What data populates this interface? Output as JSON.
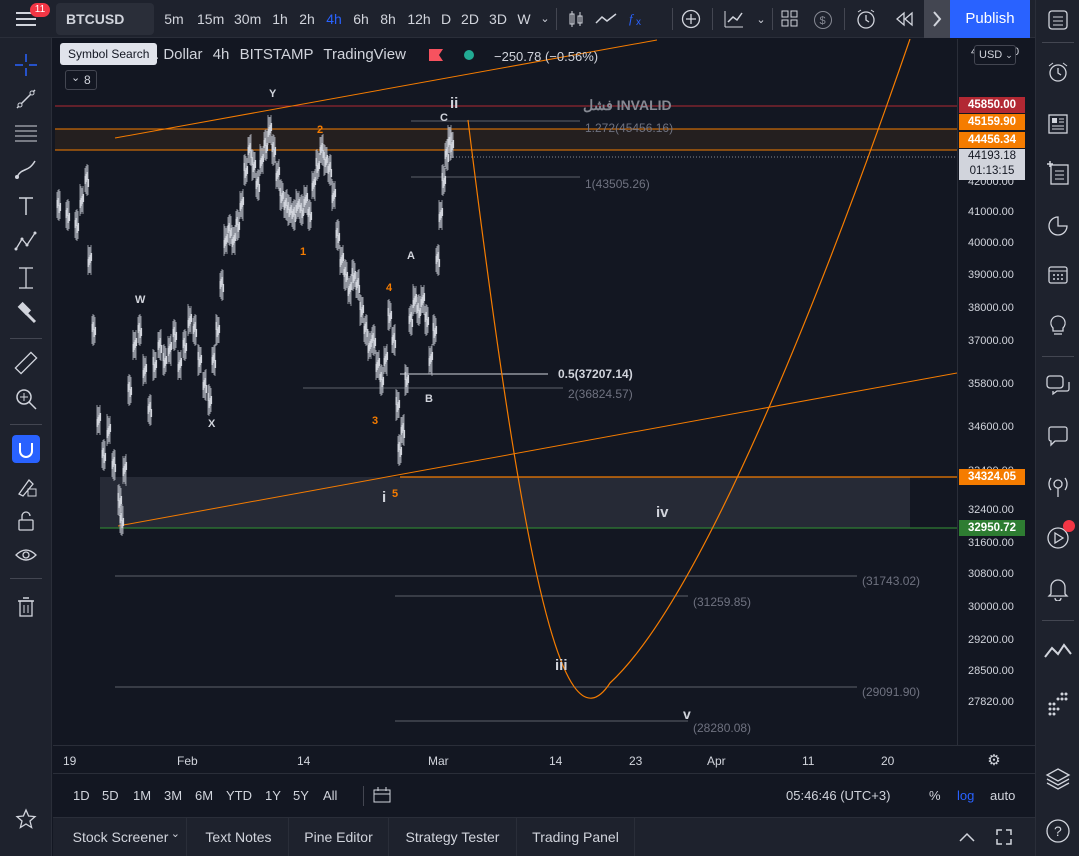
{
  "header": {
    "menu_badge": "11",
    "symbol": "BTCUSD",
    "tooltip": "Symbol Search",
    "intervals": [
      "5m",
      "15m",
      "30m",
      "1h",
      "2h",
      "4h",
      "6h",
      "8h",
      "12h",
      "D",
      "2D",
      "3D",
      "W"
    ],
    "active_interval": "4h",
    "publish_label": "Publish"
  },
  "legend": {
    "title_fragment": "S. Dollar",
    "interval": "4h",
    "exchange": "BITSTAMP",
    "source": "TradingView",
    "change": "−250.78 (−0.56%)",
    "indicator_count": "8"
  },
  "chart_annotations": {
    "invalid_label": "فشل INVALID",
    "fib_labels": [
      "1.272(45456.16)",
      "1(43505.26)",
      "0.5(37207.14)",
      "2(36824.57)",
      "(31743.02)",
      "(31259.85)",
      "(29091.90)",
      "(28280.08)"
    ],
    "wave_labels": [
      "Y",
      "W",
      "X",
      "2",
      "1",
      "4",
      "3",
      "5",
      "A",
      "B",
      "C",
      "i",
      "ii",
      "iii",
      "iv",
      "v"
    ]
  },
  "price_axis": {
    "currency": "USD",
    "top_partial": "4",
    "top_partial_suffix": "0",
    "ticks": [
      "42000.00",
      "41000.00",
      "40000.00",
      "39000.00",
      "38000.00",
      "37000.00",
      "35800.00",
      "34600.00",
      "33400.00",
      "32400.00",
      "31600.00",
      "30800.00",
      "30000.00",
      "29200.00",
      "28500.00",
      "27820.00"
    ],
    "tags": [
      {
        "value": "45850.00",
        "color": "#b22833"
      },
      {
        "value": "45159.90",
        "color": "#f57c00"
      },
      {
        "value": "44456.34",
        "color": "#f57c00"
      },
      {
        "value": "34324.05",
        "color": "#f57c00"
      },
      {
        "value": "32950.72",
        "color": "#2e7d32"
      }
    ],
    "last_price": "44193.18",
    "countdown": "01:13:15"
  },
  "time_axis": [
    "19",
    "Feb",
    "14",
    "Mar",
    "14",
    "23",
    "Apr",
    "11",
    "20"
  ],
  "range_bar": {
    "ranges": [
      "1D",
      "5D",
      "1M",
      "3M",
      "6M",
      "YTD",
      "1Y",
      "5Y",
      "All"
    ],
    "clock": "05:46:46 (UTC+3)",
    "percent": "%",
    "log": "log",
    "auto": "auto"
  },
  "bottom_tabs": [
    "Stock Screener",
    "Text Notes",
    "Pine Editor",
    "Strategy Tester",
    "Trading Panel"
  ],
  "colors": {
    "accent": "#2962ff",
    "orange": "#f57c00",
    "red": "#b22833",
    "green": "#2e7d32"
  }
}
